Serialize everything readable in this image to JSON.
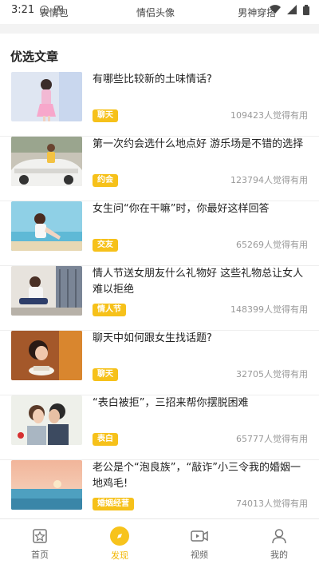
{
  "status": {
    "time": "3:21"
  },
  "categories": [
    "表情包",
    "情侣头像",
    "男神穿搭"
  ],
  "section": {
    "title": "优选文章"
  },
  "articles": [
    {
      "title": "有哪些比较新的土味情话?",
      "tag": "聊天",
      "likes": "109423人觉得有用"
    },
    {
      "title": "第一次约会选什么地点好 游乐场是不错的选择",
      "tag": "约会",
      "likes": "123794人觉得有用"
    },
    {
      "title": "女生问“你在干嘛”时，你最好这样回答",
      "tag": "交友",
      "likes": "65269人觉得有用"
    },
    {
      "title": "情人节送女朋友什么礼物好 这些礼物总让女人难以拒绝",
      "tag": "情人节",
      "likes": "148399人觉得有用"
    },
    {
      "title": "聊天中如何跟女生找话题?",
      "tag": "聊天",
      "likes": "32705人觉得有用"
    },
    {
      "title": "“表白被拒”，三招来帮你摆脱困难",
      "tag": "表白",
      "likes": "65777人觉得有用"
    },
    {
      "title": "老公是个“泡良族”，“敲诈”小三令我的婚姻一地鸡毛!",
      "tag": "婚姻经营",
      "likes": "74013人觉得有用"
    }
  ],
  "nav": [
    {
      "label": "首页",
      "icon": "home-icon"
    },
    {
      "label": "发现",
      "icon": "discover-icon"
    },
    {
      "label": "视频",
      "icon": "video-icon"
    },
    {
      "label": "我的",
      "icon": "profile-icon"
    }
  ],
  "colors": {
    "accent": "#f6c11a",
    "active_nav": "#f2b705"
  }
}
